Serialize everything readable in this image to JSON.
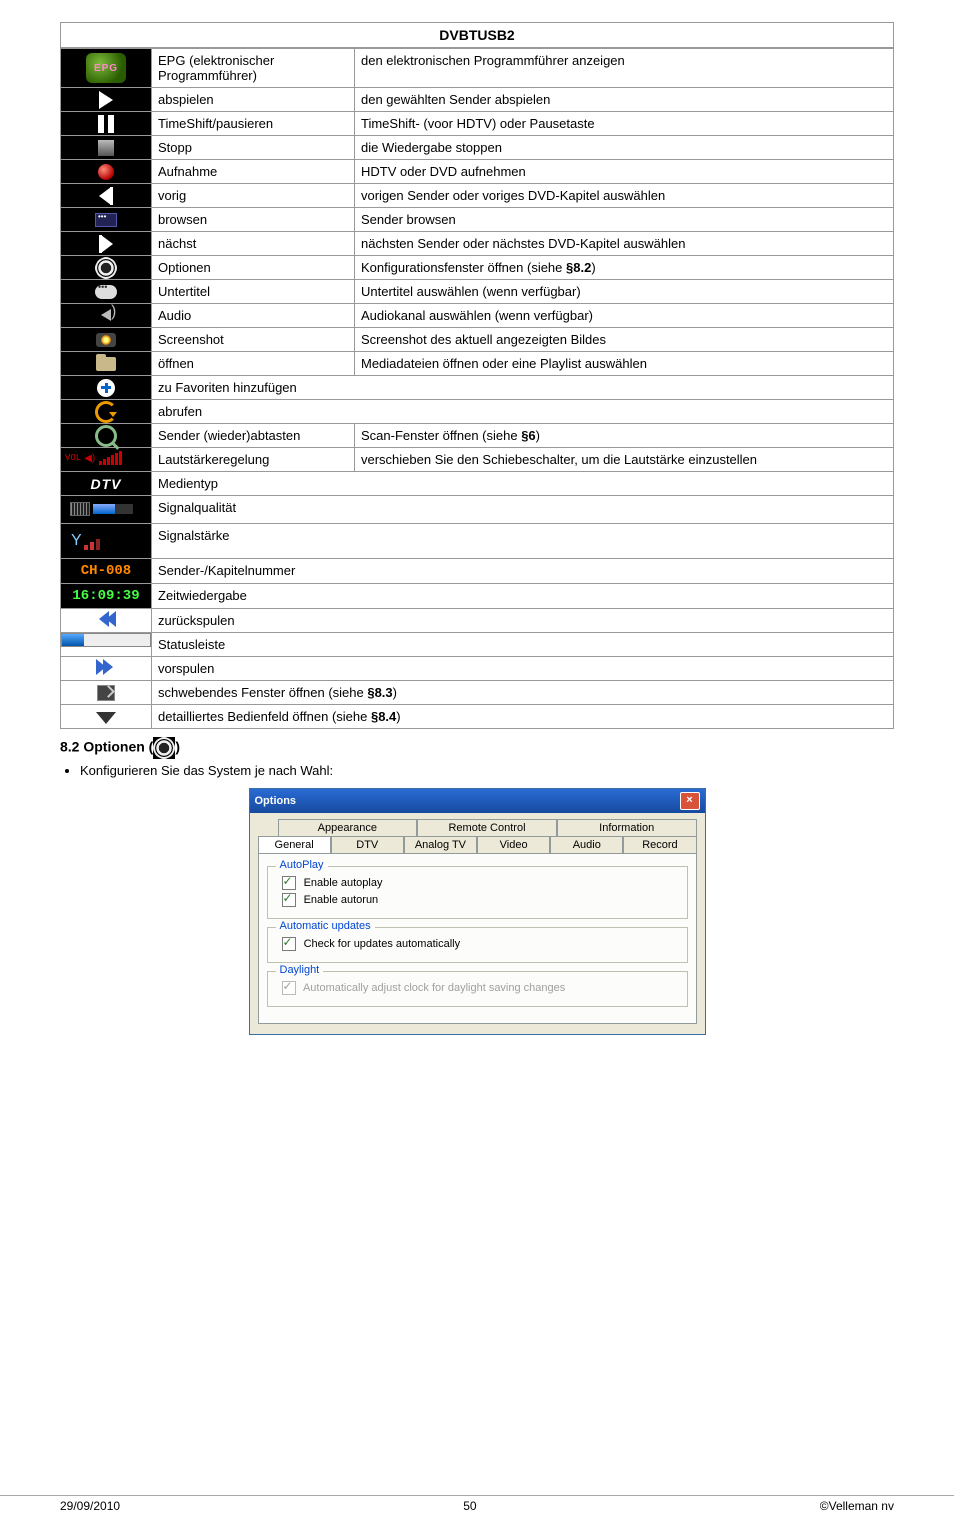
{
  "title": "DVBTUSB2",
  "rows": [
    {
      "icon": "epg",
      "name": "EPG (elektronischer Programmführer)",
      "desc": "den elektronischen Programmführer anzeigen"
    },
    {
      "icon": "play",
      "name": "abspielen",
      "desc": "den gewählten Sender abspielen"
    },
    {
      "icon": "pause",
      "name": "TimeShift/pausieren",
      "desc": "TimeShift- (voor HDTV) oder Pausetaste"
    },
    {
      "icon": "stop",
      "name": "Stopp",
      "desc": "die Wiedergabe stoppen"
    },
    {
      "icon": "rec",
      "name": "Aufnahme",
      "desc": "HDTV oder DVD aufnehmen"
    },
    {
      "icon": "prev",
      "name": "vorig",
      "desc": "vorigen Sender oder voriges DVD-Kapitel auswählen"
    },
    {
      "icon": "browse",
      "name": "browsen",
      "desc": "Sender browsen"
    },
    {
      "icon": "next",
      "name": "nächst",
      "desc": "nächsten Sender oder nächstes DVD-Kapitel auswählen"
    },
    {
      "icon": "gear",
      "name": "Optionen",
      "desc": "Konfigurationsfenster öffnen (siehe ",
      "ref": "§8.2",
      "desc_after": ")"
    },
    {
      "icon": "subt",
      "name": "Untertitel",
      "desc": "Untertitel auswählen (wenn verfügbar)"
    },
    {
      "icon": "audio",
      "name": "Audio",
      "desc": "Audiokanal auswählen (wenn verfügbar)"
    },
    {
      "icon": "cam",
      "name": "Screenshot",
      "desc": "Screenshot des aktuell angezeigten Bildes"
    },
    {
      "icon": "folder",
      "name": "öffnen",
      "desc": "Mediadateien öffnen oder eine Playlist auswählen"
    },
    {
      "icon": "plus",
      "name": "zu Favoriten hinzufügen",
      "span": true
    },
    {
      "icon": "refresh",
      "name": "abrufen",
      "span": true
    },
    {
      "icon": "scan",
      "name": "Sender (wieder)abtasten",
      "desc": "Scan-Fenster öffnen (siehe ",
      "ref": "§6",
      "desc_after": ")"
    },
    {
      "icon": "vol",
      "name": "Lautstärkeregelung",
      "desc": "verschieben Sie den Schiebeschalter, um die Lautstärke einzustellen",
      "vol_label": "VOL"
    },
    {
      "icon": "dtv",
      "name": "Medientyp",
      "span": true,
      "dtv": "DTV"
    },
    {
      "icon": "sigq",
      "name": "Signalqualität",
      "span": true
    },
    {
      "icon": "sigs",
      "name": "Signalstärke",
      "span": true
    },
    {
      "icon": "ch",
      "name": "Sender-/Kapitelnummer",
      "span": true,
      "ch": "CH-008"
    },
    {
      "icon": "time",
      "name": "Zeitwiedergabe",
      "span": true,
      "time": "16:09:39"
    },
    {
      "icon": "rew",
      "name": "zurückspulen",
      "span": true
    },
    {
      "icon": "status",
      "name": "Statusleiste",
      "span": true
    },
    {
      "icon": "ff",
      "name": "vorspulen",
      "span": true
    },
    {
      "icon": "float",
      "name": "schwebendes Fenster öffnen (siehe ",
      "ref": "§8.3",
      "name_after": ")",
      "span": true
    },
    {
      "icon": "expand",
      "name": "detailliertes Bedienfeld öffnen (siehe ",
      "ref": "§8.4",
      "name_after": ")",
      "span": true
    }
  ],
  "section_heading": "8.2 Optionen (",
  "section_heading_after": ")",
  "bullet": "Konfigurieren Sie das System je nach Wahl:",
  "dialog": {
    "title": "Options",
    "tabs_row1": [
      "Appearance",
      "Remote Control",
      "Information"
    ],
    "tabs_row2": [
      "General",
      "DTV",
      "Analog TV",
      "Video",
      "Audio",
      "Record"
    ],
    "active_tab": "General",
    "fieldsets": [
      {
        "legend": "AutoPlay",
        "checks": [
          {
            "label": "Enable autoplay",
            "checked": true,
            "disabled": false
          },
          {
            "label": "Enable autorun",
            "checked": true,
            "disabled": false
          }
        ]
      },
      {
        "legend": "Automatic updates",
        "checks": [
          {
            "label": "Check for updates automatically",
            "checked": true,
            "disabled": false
          }
        ]
      },
      {
        "legend": "Daylight",
        "checks": [
          {
            "label": "Automatically adjust clock for daylight saving changes",
            "checked": true,
            "disabled": true
          }
        ]
      }
    ]
  },
  "footer": {
    "date": "29/09/2010",
    "page": "50",
    "copyright": "©Velleman nv"
  }
}
